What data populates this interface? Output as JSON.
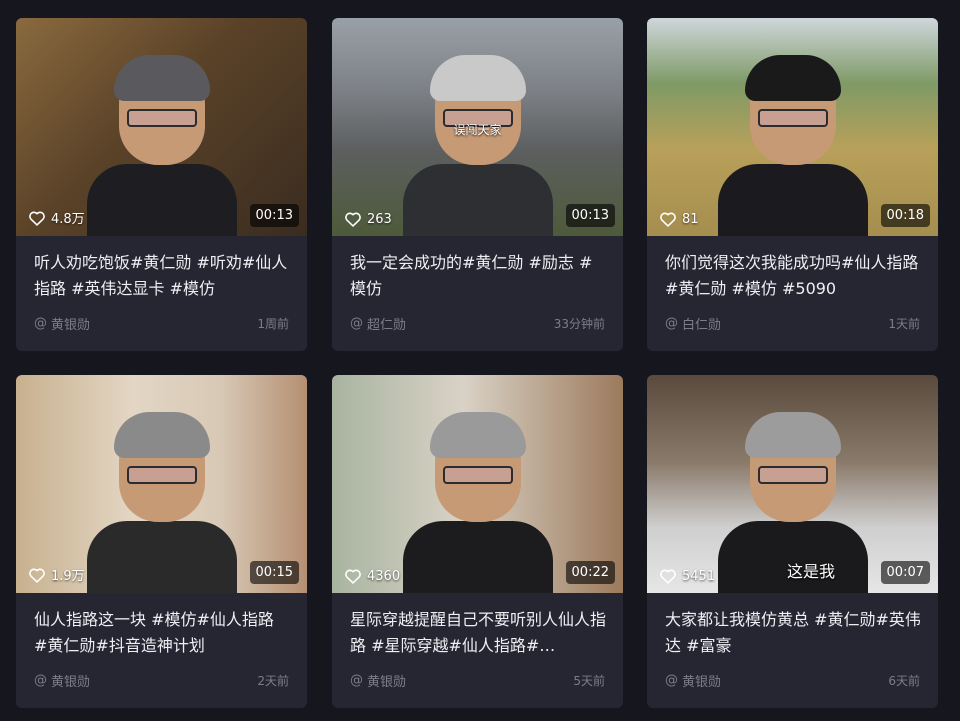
{
  "colors": {
    "page_bg": "#16161e",
    "card_bg": "#252632",
    "meta_text": "#7d7d88"
  },
  "videos": [
    {
      "likes": "4.8万",
      "duration": "00:13",
      "title": "听人劝吃饱饭#黄仁勋 #听劝#仙人指路 #英伟达显卡 #模仿",
      "author": "黄银勋",
      "time": "1周前",
      "overlay": ""
    },
    {
      "likes": "263",
      "duration": "00:13",
      "title": "我一定会成功的#黄仁勋 #励志 #模仿",
      "author": "超仁勋",
      "time": "33分钟前",
      "overlay": "误闯天家"
    },
    {
      "likes": "81",
      "duration": "00:18",
      "title": "你们觉得这次我能成功吗#仙人指路 #黄仁勋 #模仿 #5090",
      "author": "白仁勋",
      "time": "1天前",
      "overlay": ""
    },
    {
      "likes": "1.9万",
      "duration": "00:15",
      "title": "仙人指路这一块 #模仿#仙人指路 #黄仁勋#抖音造神计划",
      "author": "黄银勋",
      "time": "2天前",
      "overlay": ""
    },
    {
      "likes": "4360",
      "duration": "00:22",
      "title": "星际穿越提醒自己不要听别人仙人指路 #星际穿越#仙人指路#…",
      "author": "黄银勋",
      "time": "5天前",
      "overlay": ""
    },
    {
      "likes": "5451",
      "duration": "00:07",
      "title": "大家都让我模仿黄总 #黄仁勋#英伟达 #富豪",
      "author": "黄银勋",
      "time": "6天前",
      "overlay": "这是我"
    }
  ]
}
